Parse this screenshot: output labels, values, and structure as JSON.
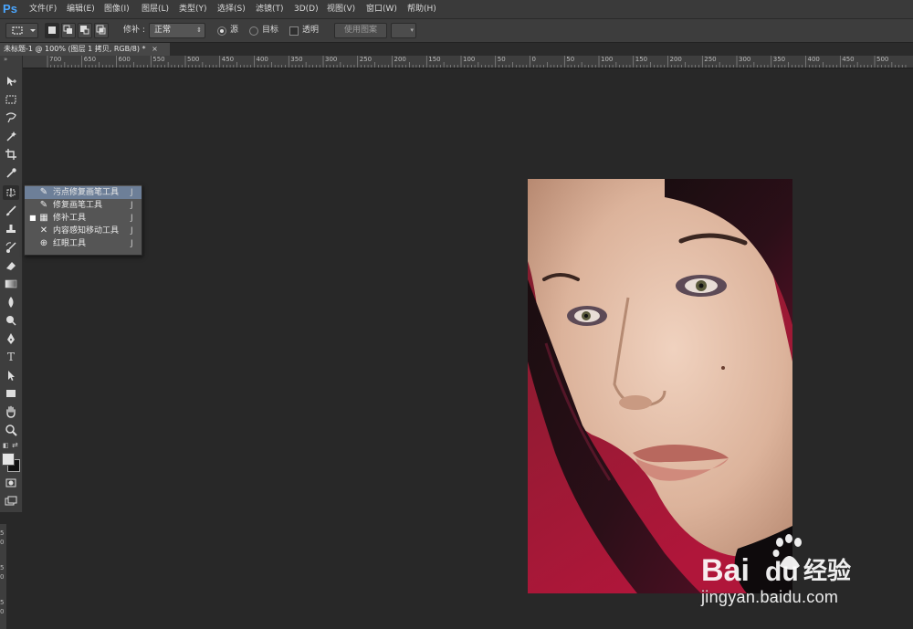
{
  "app": {
    "logo": "Ps"
  },
  "menu": [
    "文件(F)",
    "编辑(E)",
    "图像(I)",
    "图层(L)",
    "类型(Y)",
    "选择(S)",
    "滤镜(T)",
    "3D(D)",
    "视图(V)",
    "窗口(W)",
    "帮助(H)"
  ],
  "options": {
    "patch_label": "修补 :",
    "patch_mode": "正常",
    "source_label": "源",
    "dest_label": "目标",
    "transparent_label": "透明",
    "use_pattern_label": "使用图案",
    "selected_mode": "source"
  },
  "document": {
    "tab_title": "未标题-1 @ 100% (图层 1 拷贝, RGB/8) *",
    "close_glyph": "×"
  },
  "ruler": {
    "h_labels": [
      "700",
      "650",
      "600",
      "550",
      "500",
      "450",
      "400",
      "350",
      "300",
      "250",
      "200",
      "150",
      "100",
      "50",
      "0",
      "50",
      "100",
      "150",
      "200",
      "250",
      "300",
      "350",
      "400",
      "450",
      "500"
    ],
    "v_labels": [
      "5",
      "0",
      "5",
      "0",
      "5",
      "0"
    ]
  },
  "tools": [
    "move-tool",
    "marquee-tool",
    "lasso-tool",
    "magic-wand-tool",
    "crop-tool",
    "eyedropper-tool",
    "healing-tool",
    "brush-tool",
    "stamp-tool",
    "history-brush-tool",
    "eraser-tool",
    "gradient-tool",
    "blur-tool",
    "dodge-tool",
    "pen-tool",
    "type-tool",
    "path-selection-tool",
    "rectangle-tool",
    "hand-tool",
    "zoom-tool"
  ],
  "flyout": {
    "items": [
      {
        "label": "污点修复画笔工具",
        "key": "J",
        "icon": "spot-healing-brush-icon",
        "highlighted": true,
        "current": false
      },
      {
        "label": "修复画笔工具",
        "key": "J",
        "icon": "healing-brush-icon",
        "highlighted": false,
        "current": false
      },
      {
        "label": "修补工具",
        "key": "J",
        "icon": "patch-icon",
        "highlighted": false,
        "current": true
      },
      {
        "label": "内容感知移动工具",
        "key": "J",
        "icon": "content-aware-move-icon",
        "highlighted": false,
        "current": false
      },
      {
        "label": "红眼工具",
        "key": "J",
        "icon": "red-eye-icon",
        "highlighted": false,
        "current": false
      }
    ]
  },
  "colors": {
    "foreground": "#e6e6e6",
    "background": "#111111",
    "accent_highlight": "#6d7f98"
  },
  "watermark": {
    "brand": "Bai",
    "brand_du": "du",
    "brand_cn": "经验",
    "url": "jingyan.baidu.com"
  }
}
